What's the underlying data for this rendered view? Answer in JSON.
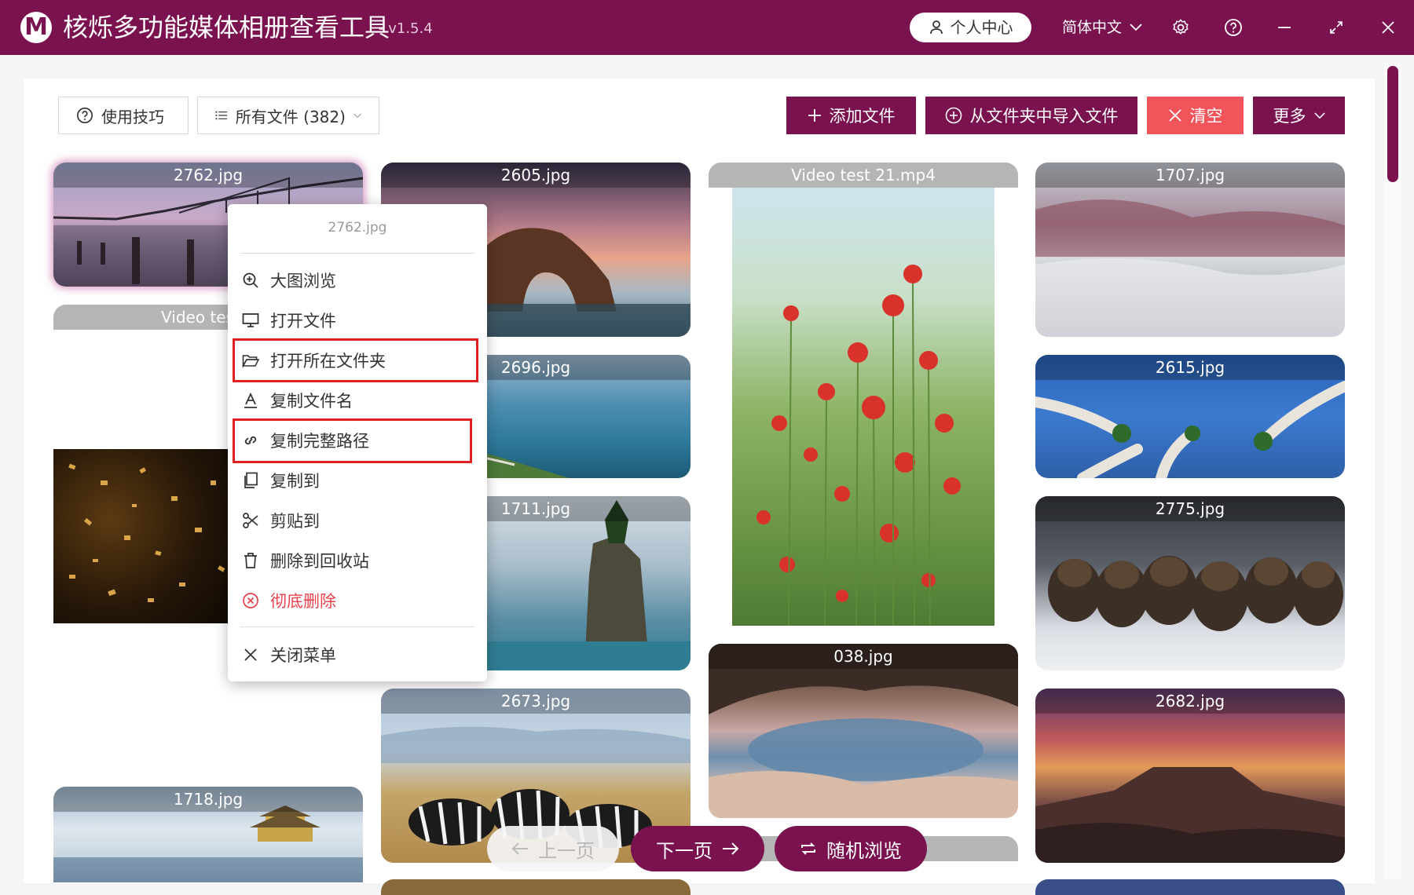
{
  "app": {
    "logo_letter": "M",
    "title": "核烁多功能媒体相册查看工具",
    "version": "- v1.5.4",
    "user_center": "个人中心",
    "language": "简体中文"
  },
  "toolbar": {
    "tips_label": "使用技巧",
    "filter_label": "所有文件 (382)",
    "add_files_label": "添加文件",
    "import_folder_label": "从文件夹中导入文件",
    "clear_label": "清空",
    "more_label": "更多"
  },
  "gallery": {
    "tiles": [
      {
        "label": "2762.jpg"
      },
      {
        "label": "Video test 2"
      },
      {
        "label": "1718.jpg"
      },
      {
        "label": "2605.jpg"
      },
      {
        "label": "2696.jpg"
      },
      {
        "label": "1711.jpg"
      },
      {
        "label": "2673.jpg"
      },
      {
        "label": "Video test 21.mp4"
      },
      {
        "label": "038.jpg"
      },
      {
        "label": "1707.jpg"
      },
      {
        "label": "2615.jpg"
      },
      {
        "label": "2775.jpg"
      },
      {
        "label": "2682.jpg"
      }
    ]
  },
  "context_menu": {
    "title": "2762.jpg",
    "items": [
      {
        "label": "大图浏览",
        "icon": "zoom-in-icon"
      },
      {
        "label": "打开文件",
        "icon": "monitor-icon"
      },
      {
        "label": "打开所在文件夹",
        "icon": "folder-open-icon"
      },
      {
        "label": "复制文件名",
        "icon": "text-a-icon"
      },
      {
        "label": "复制完整路径",
        "icon": "link-icon"
      },
      {
        "label": "复制到",
        "icon": "copy-icon"
      },
      {
        "label": "剪贴到",
        "icon": "scissors-icon"
      },
      {
        "label": "删除到回收站",
        "icon": "trash-icon"
      },
      {
        "label": "彻底删除",
        "icon": "delete-circle-icon"
      },
      {
        "label": "关闭菜单",
        "icon": "close-icon"
      }
    ]
  },
  "pagination": {
    "prev_label": "上一页",
    "next_label": "下一页",
    "random_label": "随机浏览"
  },
  "colors": {
    "brand": "#7a1250",
    "danger": "#f2545b",
    "highlight": "#e02020"
  }
}
